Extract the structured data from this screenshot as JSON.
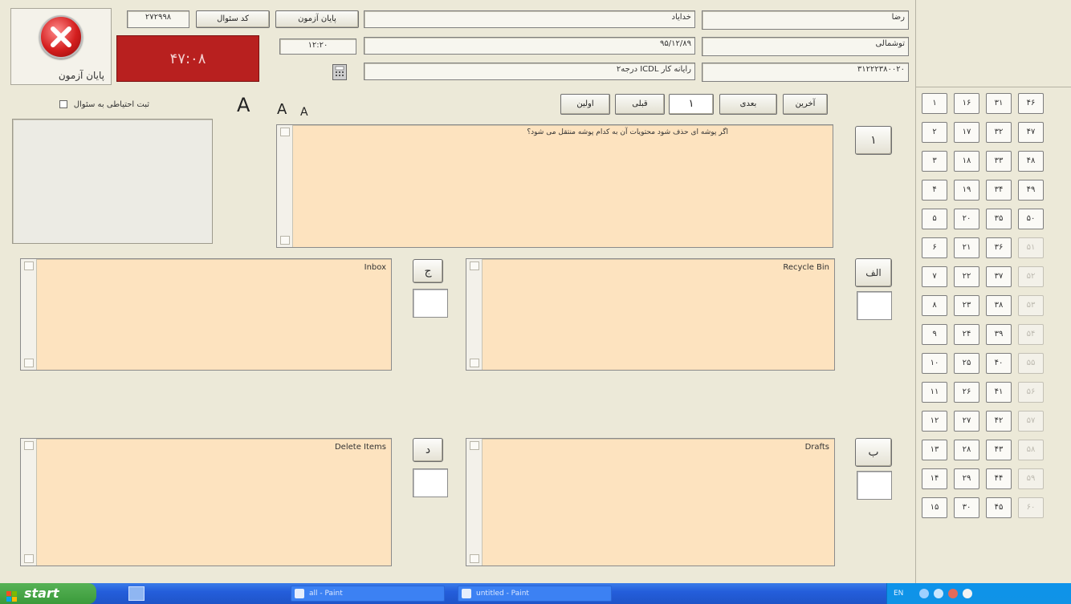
{
  "header": {
    "end_exam_label": "پایان آزمون",
    "timer_value": "۴۷:۰۸",
    "question_code_value": "۲۷۲۹۹۸",
    "question_code_label": "کد سئوال",
    "exam_end_time_label": "پایان آزمون",
    "exam_end_time_value": "۱۲:۲۰",
    "first_name_label": "خدایاد",
    "first_name_value": "رضا",
    "date_value": "۹۵/۱۲/۸۹",
    "last_name_value": "توشمالی",
    "course_value": "رایانه کار ICDL درجه۲",
    "national_id_value": "۳۱۲۲۲۳۸۰۰۲۰"
  },
  "controls": {
    "flag_label": "ثبت احتیاطی به سئوال",
    "font_large": "A",
    "font_medium": "A",
    "font_small": "A",
    "nav_last": "آخرین",
    "nav_next": "بعدی",
    "nav_current": "۱",
    "nav_prev": "قبلی",
    "nav_first": "اولین"
  },
  "question": {
    "number": "۱",
    "text": "اگر پوشه ای حذف شود محتویات آن به کدام پوشه منتقل می شود؟"
  },
  "options": [
    {
      "letter": "الف",
      "text": "Recycle Bin"
    },
    {
      "letter": "ج",
      "text": "Inbox"
    },
    {
      "letter": "ب",
      "text": "Drafts"
    },
    {
      "letter": "د",
      "text": "Delete Items"
    }
  ],
  "question_grid": [
    [
      "۱",
      "۱۶",
      "۳۱",
      "۴۶"
    ],
    [
      "۲",
      "۱۷",
      "۳۲",
      "۴۷"
    ],
    [
      "۳",
      "۱۸",
      "۳۳",
      "۴۸"
    ],
    [
      "۴",
      "۱۹",
      "۳۴",
      "۴۹"
    ],
    [
      "۵",
      "۲۰",
      "۳۵",
      "۵۰"
    ],
    [
      "۶",
      "۲۱",
      "۳۶",
      "۵۱"
    ],
    [
      "۷",
      "۲۲",
      "۳۷",
      "۵۲"
    ],
    [
      "۸",
      "۲۳",
      "۳۸",
      "۵۳"
    ],
    [
      "۹",
      "۲۴",
      "۳۹",
      "۵۴"
    ],
    [
      "۱۰",
      "۲۵",
      "۴۰",
      "۵۵"
    ],
    [
      "۱۱",
      "۲۶",
      "۴۱",
      "۵۶"
    ],
    [
      "۱۲",
      "۲۷",
      "۴۲",
      "۵۷"
    ],
    [
      "۱۳",
      "۲۸",
      "۴۳",
      "۵۸"
    ],
    [
      "۱۴",
      "۲۹",
      "۴۴",
      "۵۹"
    ],
    [
      "۱۵",
      "۳۰",
      "۴۵",
      "۶۰"
    ]
  ],
  "question_grid_dim_from": "۵۱",
  "taskbar": {
    "start_label": "start",
    "task1": "all - Paint",
    "task2": "untitled - Paint",
    "tray_lang": "EN"
  }
}
